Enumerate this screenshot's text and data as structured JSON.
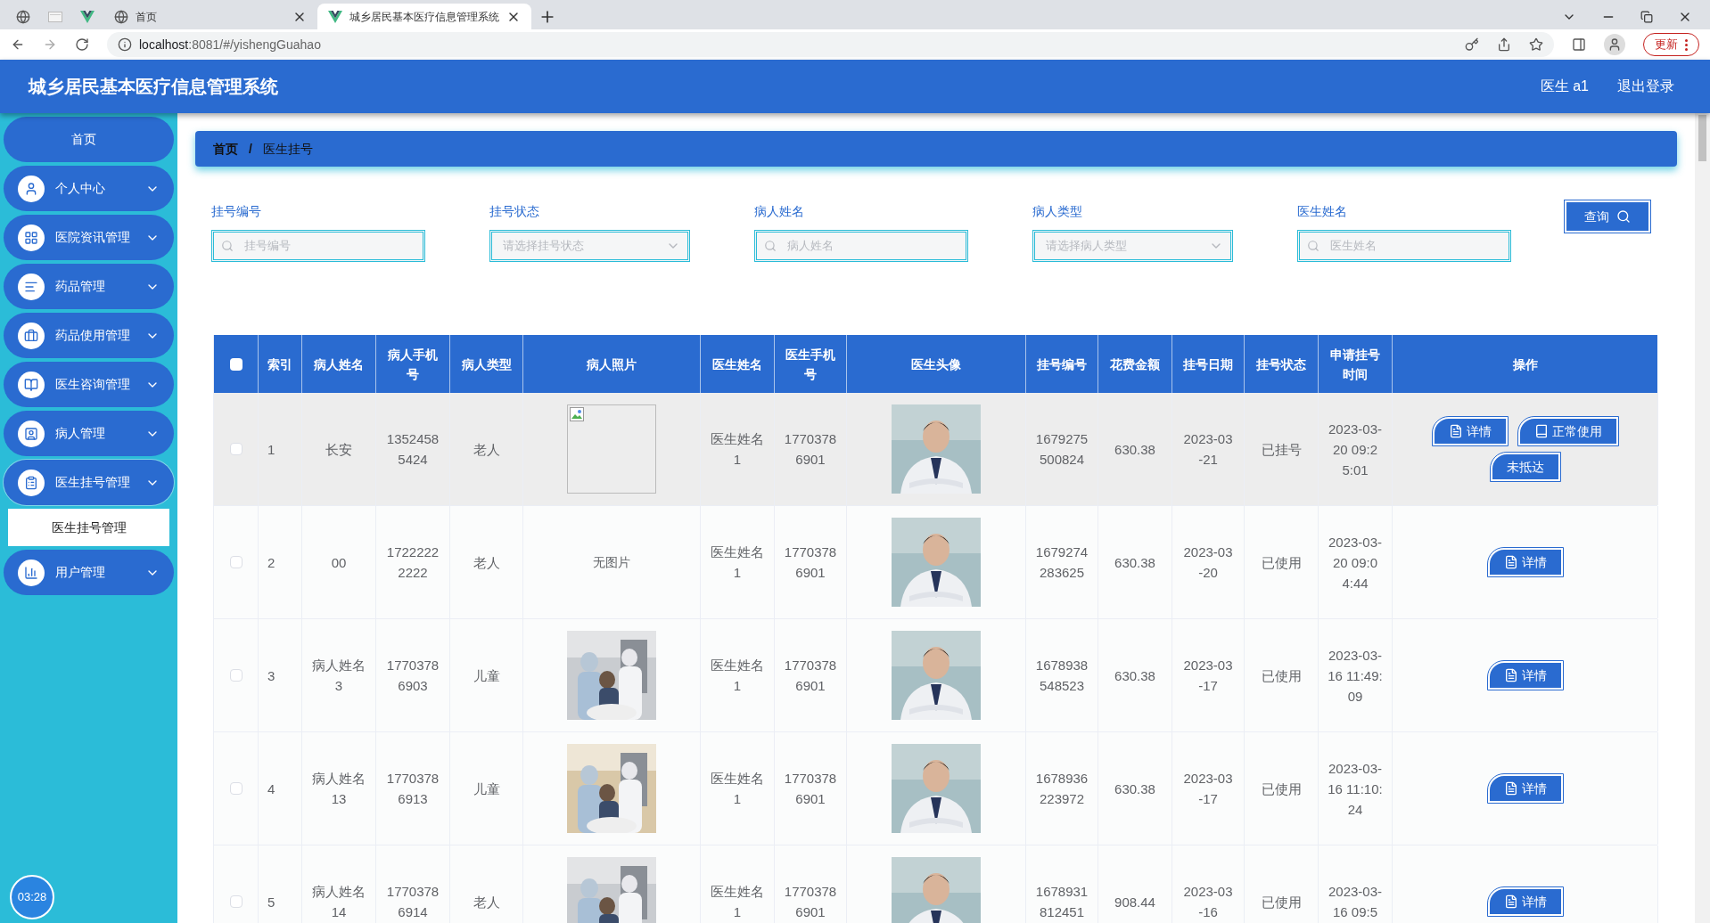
{
  "browser": {
    "tabs": [
      {
        "selected": false,
        "kind": "globe"
      },
      {
        "selected": false,
        "kind": "sheet"
      },
      {
        "selected": false,
        "kind": "vue"
      },
      {
        "label": "首页",
        "selected": false,
        "kind": "globe"
      },
      {
        "label": "城乡居民基本医疗信息管理系统",
        "selected": true,
        "kind": "vue"
      }
    ],
    "url_host": "localhost",
    "url_rest": ":8081/#/yishengGuahao",
    "update_button": "更新"
  },
  "header": {
    "title": "城乡居民基本医疗信息管理系统",
    "user": "医生 a1",
    "logout": "退出登录"
  },
  "sidebar": {
    "items": [
      {
        "label": "首页",
        "expanded": false
      },
      {
        "label": "个人中心",
        "expanded": false
      },
      {
        "label": "医院资讯管理",
        "expanded": false
      },
      {
        "label": "药品管理",
        "expanded": false
      },
      {
        "label": "药品使用管理",
        "expanded": false
      },
      {
        "label": "医生咨询管理",
        "expanded": false
      },
      {
        "label": "病人管理",
        "expanded": false
      },
      {
        "label": "医生挂号管理",
        "expanded": true,
        "children": [
          {
            "label": "医生挂号管理",
            "selected": true
          }
        ]
      },
      {
        "label": "用户管理",
        "expanded": false
      }
    ],
    "clock": "03:28"
  },
  "breadcrumb": {
    "items": [
      "首页",
      "医生挂号"
    ],
    "separator": "/"
  },
  "filters": [
    {
      "label": "挂号编号",
      "kind": "text",
      "placeholder": "挂号编号"
    },
    {
      "label": "挂号状态",
      "kind": "select",
      "placeholder": "请选择挂号状态"
    },
    {
      "label": "病人姓名",
      "kind": "text",
      "placeholder": "病人姓名"
    },
    {
      "label": "病人类型",
      "kind": "select",
      "placeholder": "请选择病人类型"
    },
    {
      "label": "医生姓名",
      "kind": "text",
      "placeholder": "医生姓名"
    }
  ],
  "search_button": "查询",
  "table": {
    "all_selected": false,
    "columns": [
      "索引",
      "病人姓名",
      "病人手机号",
      "病人类型",
      "病人照片",
      "医生姓名",
      "医生手机号",
      "医生头像",
      "挂号编号",
      "花费金额",
      "挂号日期",
      "挂号状态",
      "申请挂号时间",
      "操作"
    ],
    "rows": [
      {
        "selected": false,
        "hovered": true,
        "index": "1",
        "patient": "长安",
        "patient_phone": "13524585424",
        "patient_type": "老人",
        "photo": {
          "kind": "broken"
        },
        "doctor": "医生姓名1",
        "doctor_phone": "17703786901",
        "number": "1679275500824",
        "amount": "630.38",
        "date": "2023-03-21",
        "status": "已挂号",
        "time": "2023-03-20 09:25:01",
        "actions": [
          {
            "label": "详情",
            "kind": "detail"
          },
          {
            "label": "正常使用",
            "kind": "book"
          },
          {
            "label": "未抵达",
            "kind": "plain"
          }
        ]
      },
      {
        "selected": false,
        "hovered": false,
        "index": "2",
        "patient": "00",
        "patient_phone": "17222222222",
        "patient_type": "老人",
        "photo": {
          "kind": "none",
          "text": "无图片"
        },
        "doctor": "医生姓名1",
        "doctor_phone": "17703786901",
        "number": "1679274283625",
        "amount": "630.38",
        "date": "2023-03-20",
        "status": "已使用",
        "time": "2023-03-20 09:04:44",
        "actions": [
          {
            "label": "详情",
            "kind": "detail"
          }
        ]
      },
      {
        "selected": false,
        "hovered": false,
        "index": "3",
        "patient": "病人姓名3",
        "patient_phone": "17703786903",
        "patient_type": "儿童",
        "photo": {
          "kind": "picture"
        },
        "doctor": "医生姓名1",
        "doctor_phone": "17703786901",
        "number": "1678938548523",
        "amount": "630.38",
        "date": "2023-03-17",
        "status": "已使用",
        "time": "2023-03-16 11:49:09",
        "actions": [
          {
            "label": "详情",
            "kind": "detail"
          }
        ]
      },
      {
        "selected": false,
        "hovered": false,
        "index": "4",
        "patient": "病人姓名13",
        "patient_phone": "17703786913",
        "patient_type": "儿童",
        "photo": {
          "kind": "picture"
        },
        "doctor": "医生姓名1",
        "doctor_phone": "17703786901",
        "number": "1678936223972",
        "amount": "630.38",
        "date": "2023-03-17",
        "status": "已使用",
        "time": "2023-03-16 11:10:24",
        "actions": [
          {
            "label": "详情",
            "kind": "detail"
          }
        ]
      },
      {
        "selected": false,
        "hovered": false,
        "index": "5",
        "patient": "病人姓名14",
        "patient_phone": "17703786914",
        "patient_type": "老人",
        "photo": {
          "kind": "picture"
        },
        "doctor": "医生姓名1",
        "doctor_phone": "17703786901",
        "number": "1678931812451",
        "amount": "908.44",
        "date": "2023-03-16",
        "status": "已使用",
        "time": "2023-03-16 09:5",
        "actions": [
          {
            "label": "详情",
            "kind": "detail"
          }
        ]
      }
    ]
  }
}
